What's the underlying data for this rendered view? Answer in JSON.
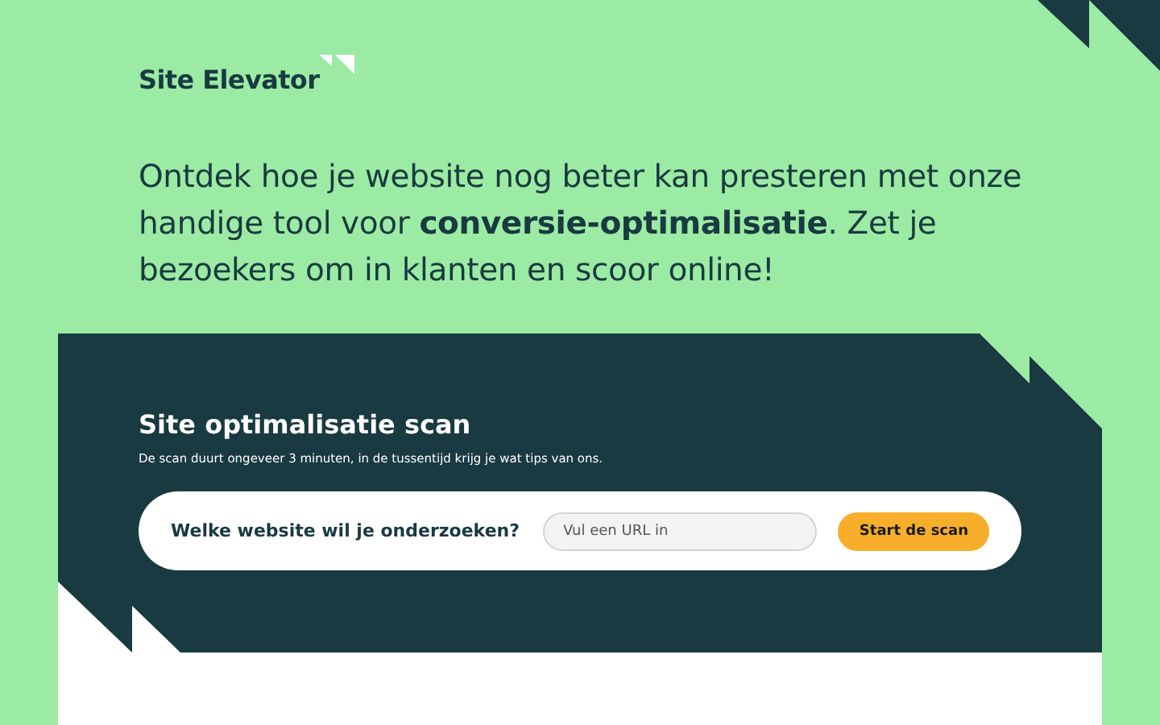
{
  "brand": {
    "name": "Site Elevator"
  },
  "intro": "Ontdek hoe je website nog beter kan presteren met onze handige tool voor **conversie-optimalisatie**. Zet je bezoekers om in klanten en scoor online!",
  "scan": {
    "title": "Site optimalisatie scan",
    "subtitle": "De scan duurt ongeveer 3 minuten, in de tussentijd krijg je wat tips van ons.",
    "question": "Welke website wil je onderzoeken?",
    "placeholder": "Vul een URL in",
    "button": "Start de scan"
  }
}
